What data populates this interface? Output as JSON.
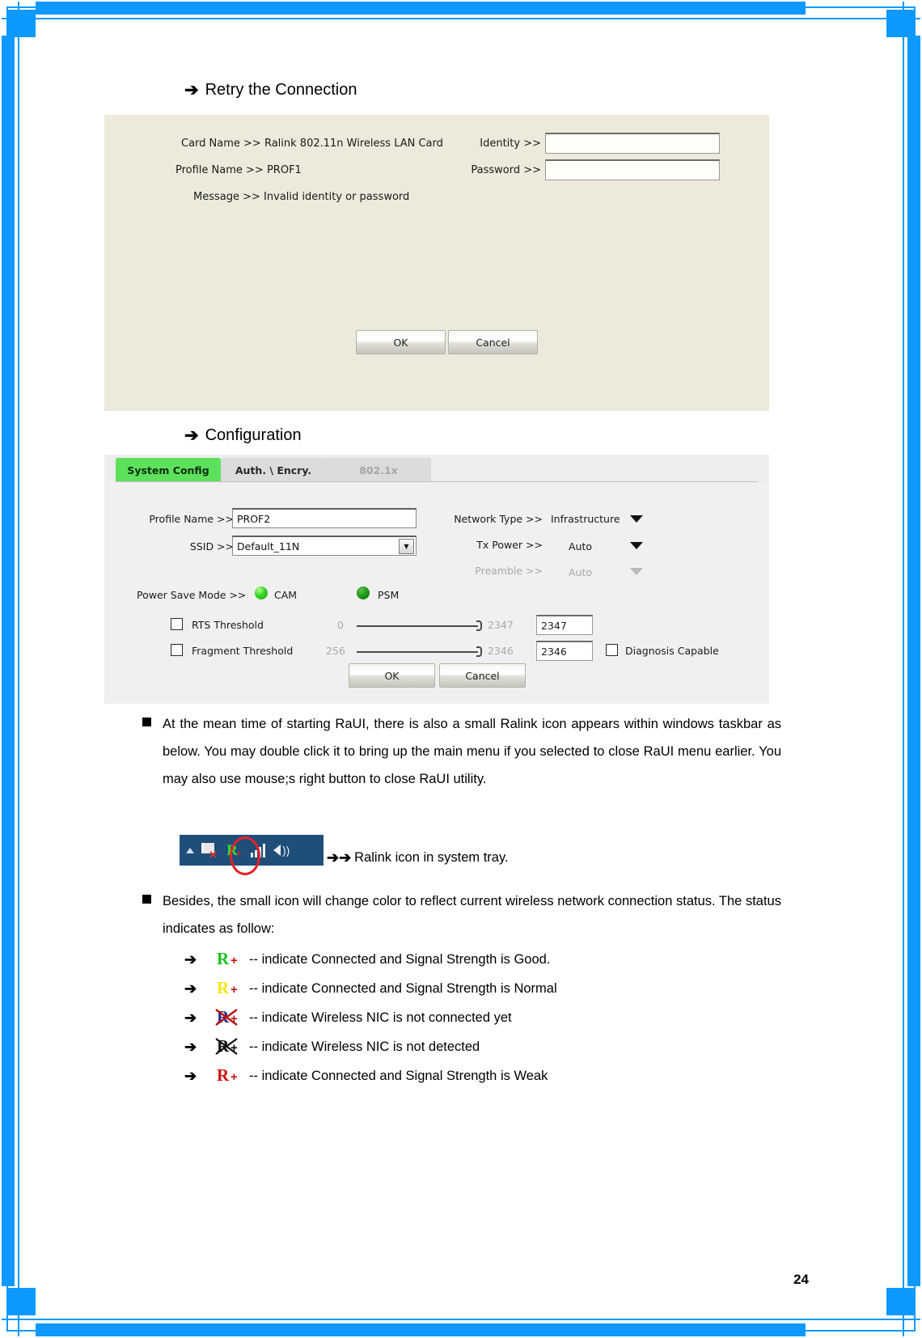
{
  "page": {
    "number": "24",
    "frame_color": "#0d99ff"
  },
  "headings": {
    "retry": {
      "arrow": "➔",
      "text": "Retry the Connection"
    },
    "configuration": {
      "arrow": "➔",
      "text": "Configuration"
    }
  },
  "retry_dialog": {
    "card_name_label": "Card Name >>",
    "card_name_value": "Ralink 802.11n Wireless LAN Card",
    "profile_name_label": "Profile Name >>",
    "profile_name_value": "PROF1",
    "message_label": "Message >>",
    "message_value": "Invalid identity or password",
    "identity_label": "Identity >>",
    "identity_value": "",
    "password_label": "Password >>",
    "password_value": "",
    "ok_label": "OK",
    "cancel_label": "Cancel",
    "background_color": "#eceadb"
  },
  "config_dialog": {
    "tabs": [
      {
        "label": "System Config",
        "state": "active"
      },
      {
        "label": "Auth. \\ Encry.",
        "state": "inactive"
      },
      {
        "label": "802.1x",
        "state": "disabled"
      }
    ],
    "profile_name_label": "Profile Name >>",
    "profile_name_value": "PROF2",
    "ssid_label": "SSID >>",
    "ssid_value": "Default_11N",
    "network_type_label": "Network Type >>",
    "network_type_value": "Infrastructure",
    "tx_power_label": "Tx Power >>",
    "tx_power_value": "Auto",
    "preamble_label": "Preamble >>",
    "preamble_value": "Auto",
    "power_save_label": "Power Save Mode >>",
    "cam_label": "CAM",
    "psm_label": "PSM",
    "rts_label": "RTS Threshold",
    "rts_min": "0",
    "rts_max": "2347",
    "rts_value": "2347",
    "frag_label": "Fragment Threshold",
    "frag_min": "256",
    "frag_max": "2346",
    "frag_value": "2346",
    "diagnosis_label": "Diagnosis Capable",
    "ok_label": "OK",
    "cancel_label": "Cancel",
    "active_tab_color": "#5de15d"
  },
  "paragraphs": {
    "tray_intro": "At the mean time of starting RaUI, there is also a small Ralink icon appears within windows taskbar as below. You may double click it to bring up the main menu if you selected to close RaUI menu earlier. You may also use mouse;s right button to close RaUI utility.",
    "status_intro": "Besides, the small icon will change color to reflect current wireless network connection status. The status indicates as follow:"
  },
  "tray_caption": {
    "arrows": "➔➔",
    "text": "Ralink icon in system tray."
  },
  "legend": {
    "arrow": "➔",
    "items": [
      {
        "icon": "ralink-icon-green",
        "letter": "R",
        "plus": "+",
        "letter_color": "#18c21c",
        "plus_color": "#c21212",
        "struck": false,
        "text": "-- indicate Connected and Signal Strength is Good."
      },
      {
        "icon": "ralink-icon-yellow",
        "letter": "R",
        "plus": "+",
        "letter_color": "#f5e613",
        "plus_color": "#c21212",
        "struck": false,
        "text": "-- indicate Connected and Signal Strength is Normal"
      },
      {
        "icon": "ralink-icon-blue-crossed",
        "letter": "R",
        "plus": "+",
        "letter_color": "#2a2a8c",
        "plus_color": "#c21212",
        "struck": true,
        "strike_color": "#b41414",
        "text": "-- indicate Wireless NIC is not connected yet"
      },
      {
        "icon": "ralink-icon-black-crossed",
        "letter": "R",
        "plus": "+",
        "letter_color": "#111111",
        "plus_color": "#111111",
        "struck": true,
        "strike_color": "#111111",
        "text": "-- indicate Wireless NIC is not detected"
      },
      {
        "icon": "ralink-icon-red",
        "letter": "R",
        "plus": "+",
        "letter_color": "#cc1111",
        "plus_color": "#cc1111",
        "struck": false,
        "text": "-- indicate Connected and Signal Strength is Weak"
      }
    ]
  }
}
